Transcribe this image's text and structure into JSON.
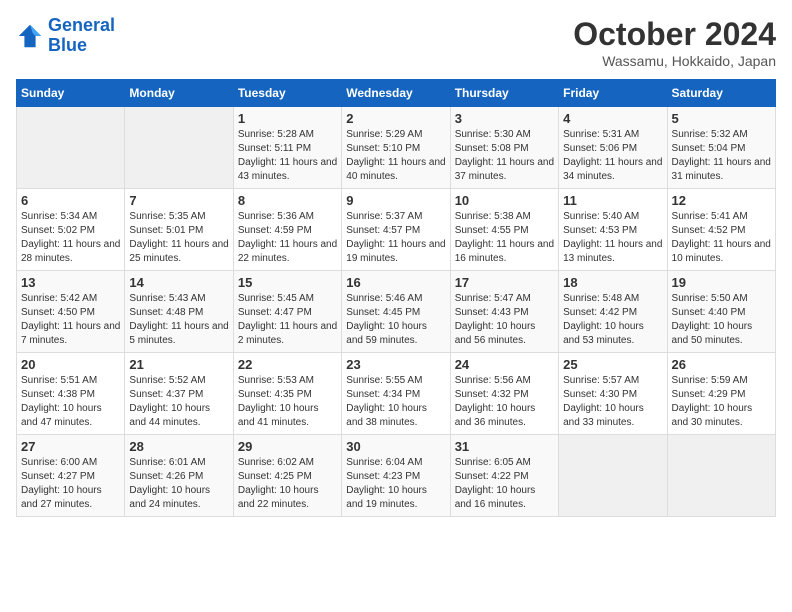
{
  "header": {
    "logo_line1": "General",
    "logo_line2": "Blue",
    "month": "October 2024",
    "location": "Wassamu, Hokkaido, Japan"
  },
  "weekdays": [
    "Sunday",
    "Monday",
    "Tuesday",
    "Wednesday",
    "Thursday",
    "Friday",
    "Saturday"
  ],
  "weeks": [
    [
      {
        "day": "",
        "sunrise": "",
        "sunset": "",
        "daylight": ""
      },
      {
        "day": "",
        "sunrise": "",
        "sunset": "",
        "daylight": ""
      },
      {
        "day": "1",
        "sunrise": "Sunrise: 5:28 AM",
        "sunset": "Sunset: 5:11 PM",
        "daylight": "Daylight: 11 hours and 43 minutes."
      },
      {
        "day": "2",
        "sunrise": "Sunrise: 5:29 AM",
        "sunset": "Sunset: 5:10 PM",
        "daylight": "Daylight: 11 hours and 40 minutes."
      },
      {
        "day": "3",
        "sunrise": "Sunrise: 5:30 AM",
        "sunset": "Sunset: 5:08 PM",
        "daylight": "Daylight: 11 hours and 37 minutes."
      },
      {
        "day": "4",
        "sunrise": "Sunrise: 5:31 AM",
        "sunset": "Sunset: 5:06 PM",
        "daylight": "Daylight: 11 hours and 34 minutes."
      },
      {
        "day": "5",
        "sunrise": "Sunrise: 5:32 AM",
        "sunset": "Sunset: 5:04 PM",
        "daylight": "Daylight: 11 hours and 31 minutes."
      }
    ],
    [
      {
        "day": "6",
        "sunrise": "Sunrise: 5:34 AM",
        "sunset": "Sunset: 5:02 PM",
        "daylight": "Daylight: 11 hours and 28 minutes."
      },
      {
        "day": "7",
        "sunrise": "Sunrise: 5:35 AM",
        "sunset": "Sunset: 5:01 PM",
        "daylight": "Daylight: 11 hours and 25 minutes."
      },
      {
        "day": "8",
        "sunrise": "Sunrise: 5:36 AM",
        "sunset": "Sunset: 4:59 PM",
        "daylight": "Daylight: 11 hours and 22 minutes."
      },
      {
        "day": "9",
        "sunrise": "Sunrise: 5:37 AM",
        "sunset": "Sunset: 4:57 PM",
        "daylight": "Daylight: 11 hours and 19 minutes."
      },
      {
        "day": "10",
        "sunrise": "Sunrise: 5:38 AM",
        "sunset": "Sunset: 4:55 PM",
        "daylight": "Daylight: 11 hours and 16 minutes."
      },
      {
        "day": "11",
        "sunrise": "Sunrise: 5:40 AM",
        "sunset": "Sunset: 4:53 PM",
        "daylight": "Daylight: 11 hours and 13 minutes."
      },
      {
        "day": "12",
        "sunrise": "Sunrise: 5:41 AM",
        "sunset": "Sunset: 4:52 PM",
        "daylight": "Daylight: 11 hours and 10 minutes."
      }
    ],
    [
      {
        "day": "13",
        "sunrise": "Sunrise: 5:42 AM",
        "sunset": "Sunset: 4:50 PM",
        "daylight": "Daylight: 11 hours and 7 minutes."
      },
      {
        "day": "14",
        "sunrise": "Sunrise: 5:43 AM",
        "sunset": "Sunset: 4:48 PM",
        "daylight": "Daylight: 11 hours and 5 minutes."
      },
      {
        "day": "15",
        "sunrise": "Sunrise: 5:45 AM",
        "sunset": "Sunset: 4:47 PM",
        "daylight": "Daylight: 11 hours and 2 minutes."
      },
      {
        "day": "16",
        "sunrise": "Sunrise: 5:46 AM",
        "sunset": "Sunset: 4:45 PM",
        "daylight": "Daylight: 10 hours and 59 minutes."
      },
      {
        "day": "17",
        "sunrise": "Sunrise: 5:47 AM",
        "sunset": "Sunset: 4:43 PM",
        "daylight": "Daylight: 10 hours and 56 minutes."
      },
      {
        "day": "18",
        "sunrise": "Sunrise: 5:48 AM",
        "sunset": "Sunset: 4:42 PM",
        "daylight": "Daylight: 10 hours and 53 minutes."
      },
      {
        "day": "19",
        "sunrise": "Sunrise: 5:50 AM",
        "sunset": "Sunset: 4:40 PM",
        "daylight": "Daylight: 10 hours and 50 minutes."
      }
    ],
    [
      {
        "day": "20",
        "sunrise": "Sunrise: 5:51 AM",
        "sunset": "Sunset: 4:38 PM",
        "daylight": "Daylight: 10 hours and 47 minutes."
      },
      {
        "day": "21",
        "sunrise": "Sunrise: 5:52 AM",
        "sunset": "Sunset: 4:37 PM",
        "daylight": "Daylight: 10 hours and 44 minutes."
      },
      {
        "day": "22",
        "sunrise": "Sunrise: 5:53 AM",
        "sunset": "Sunset: 4:35 PM",
        "daylight": "Daylight: 10 hours and 41 minutes."
      },
      {
        "day": "23",
        "sunrise": "Sunrise: 5:55 AM",
        "sunset": "Sunset: 4:34 PM",
        "daylight": "Daylight: 10 hours and 38 minutes."
      },
      {
        "day": "24",
        "sunrise": "Sunrise: 5:56 AM",
        "sunset": "Sunset: 4:32 PM",
        "daylight": "Daylight: 10 hours and 36 minutes."
      },
      {
        "day": "25",
        "sunrise": "Sunrise: 5:57 AM",
        "sunset": "Sunset: 4:30 PM",
        "daylight": "Daylight: 10 hours and 33 minutes."
      },
      {
        "day": "26",
        "sunrise": "Sunrise: 5:59 AM",
        "sunset": "Sunset: 4:29 PM",
        "daylight": "Daylight: 10 hours and 30 minutes."
      }
    ],
    [
      {
        "day": "27",
        "sunrise": "Sunrise: 6:00 AM",
        "sunset": "Sunset: 4:27 PM",
        "daylight": "Daylight: 10 hours and 27 minutes."
      },
      {
        "day": "28",
        "sunrise": "Sunrise: 6:01 AM",
        "sunset": "Sunset: 4:26 PM",
        "daylight": "Daylight: 10 hours and 24 minutes."
      },
      {
        "day": "29",
        "sunrise": "Sunrise: 6:02 AM",
        "sunset": "Sunset: 4:25 PM",
        "daylight": "Daylight: 10 hours and 22 minutes."
      },
      {
        "day": "30",
        "sunrise": "Sunrise: 6:04 AM",
        "sunset": "Sunset: 4:23 PM",
        "daylight": "Daylight: 10 hours and 19 minutes."
      },
      {
        "day": "31",
        "sunrise": "Sunrise: 6:05 AM",
        "sunset": "Sunset: 4:22 PM",
        "daylight": "Daylight: 10 hours and 16 minutes."
      },
      {
        "day": "",
        "sunrise": "",
        "sunset": "",
        "daylight": ""
      },
      {
        "day": "",
        "sunrise": "",
        "sunset": "",
        "daylight": ""
      }
    ]
  ]
}
